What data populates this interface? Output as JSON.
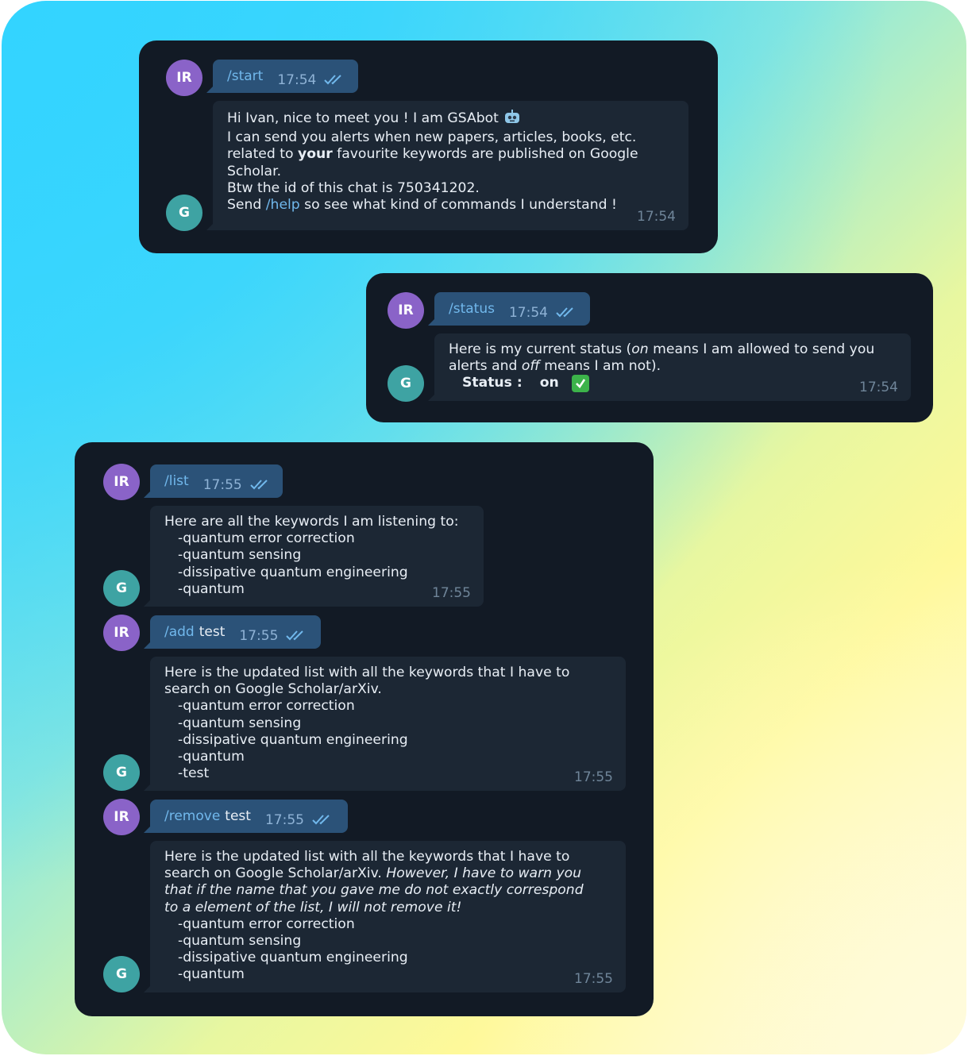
{
  "avatars": {
    "user": "IR",
    "bot": "G"
  },
  "colors": {
    "panel": "#121a25",
    "outgoing_bubble": "#2b5278",
    "incoming_bubble": "#1c2734",
    "link": "#71b8ec",
    "avatar_user": "#8a63c8",
    "avatar_bot": "#3ea3a3"
  },
  "start": {
    "command": "/start",
    "sent_time": "17:54",
    "reply": {
      "line1": "Hi Ivan,  nice to meet you ! I am GSAbot",
      "line1_icon": "robot-emoji-icon",
      "line2": "I can send you alerts when new papers, articles, books, etc.",
      "line3_pre": "related to ",
      "line3_bold": "your",
      "line3_post": " favourite keywords are published on Google",
      "line4": "Scholar.",
      "line5": "Btw the id of this chat is 750341202.",
      "line6_pre": "Send ",
      "line6_link": "/help",
      "line6_post": " so see what kind of commands I understand !",
      "time": "17:54"
    }
  },
  "status": {
    "command": "/status",
    "sent_time": "17:54",
    "reply": {
      "line1_pre": "Here is my current status (",
      "line1_em": "on",
      "line1_post": " means I am allowed to send you",
      "line2_pre": "alerts and ",
      "line2_em": "off",
      "line2_post": " means I am not).",
      "status_label": "Status :",
      "status_value": "on",
      "status_icon": "check-mark-emoji-icon",
      "time": "17:54"
    }
  },
  "list": {
    "command": "/list",
    "sent_time": "17:55",
    "reply": {
      "header": "Here are all the keywords I am listening to:",
      "items": [
        "-quantum error correction",
        "-quantum sensing",
        "-dissipative quantum engineering",
        "-quantum"
      ],
      "time": "17:55"
    }
  },
  "add": {
    "command": "/add",
    "argument": "test",
    "sent_time": "17:55",
    "reply": {
      "line1": "Here is the updated list with all the keywords that I have to",
      "line2": "search on Google Scholar/arXiv.",
      "items": [
        "-quantum error correction",
        "-quantum sensing",
        "-dissipative quantum engineering",
        "-quantum",
        "-test"
      ],
      "time": "17:55"
    }
  },
  "remove": {
    "command": "/remove",
    "argument": "test",
    "sent_time": "17:55",
    "reply": {
      "line1": "Here is the updated list with all the keywords that I have to",
      "line2_pre": "search on Google Scholar/arXiv. ",
      "line2_em": "However, I have to warn you",
      "line3_em": "that if the name that you gave me do not exactly correspond",
      "line4_em": "to a element of the list, I will not remove it!",
      "items": [
        "-quantum error correction",
        "-quantum sensing",
        "-dissipative quantum engineering",
        "-quantum"
      ],
      "time": "17:55"
    }
  }
}
